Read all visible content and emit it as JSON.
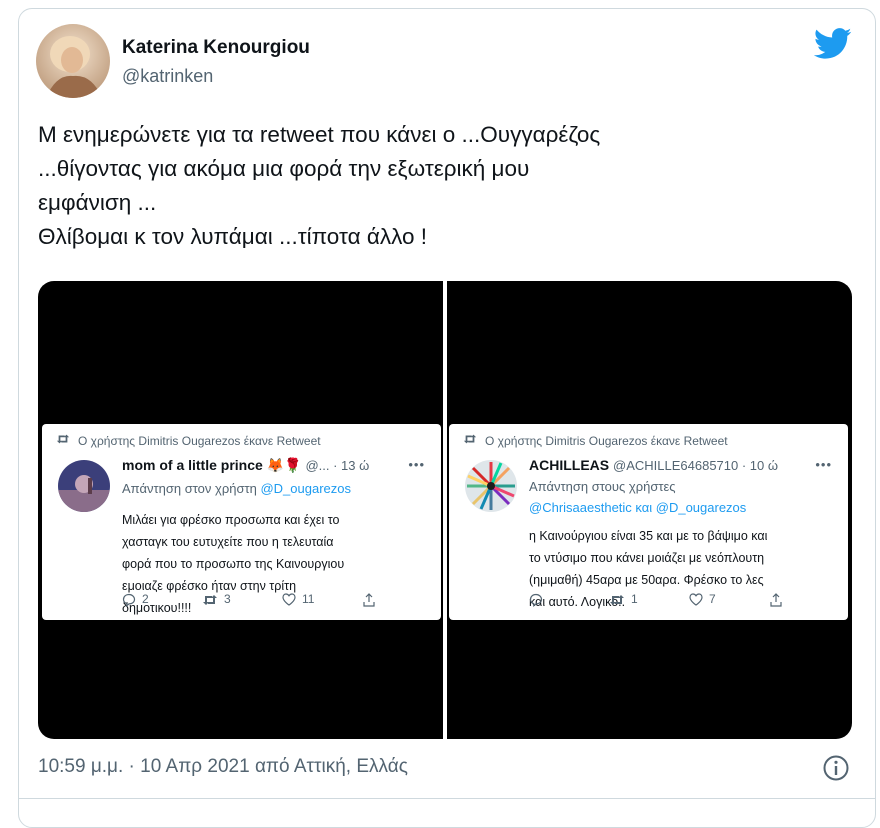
{
  "author": {
    "name": "Katerina Kenourgiou",
    "handle": "@katrinken"
  },
  "tweet": {
    "lines": [
      "Μ ενημερώνετε για τα retweet που κάνει ο ...Ουγγαρέζος",
      "...θίγοντας για ακόμα μια φορά την εξωτερική μου",
      "εμφάνιση ...",
      "Θλίβομαι κ τον λυπάμαι ...τίποτα άλλο !"
    ]
  },
  "media": {
    "left": {
      "retweet_notice": "Ο χρήστης Dimitris Ougarezos έκανε Retweet",
      "name": "mom of a little prince 🦊🌹",
      "handle_time": "@... · 13 ώ",
      "reply_prefix": "Απάντηση στον χρήστη ",
      "reply_mentions": "@D_ougarezos",
      "body_lines": [
        "Μιλάει για φρέσκο προσωπα και έχει το",
        "χασταγκ του ευτυχείτε που η τελευταία",
        "φορά που το προσωπο της Καινουργιου",
        "εμοιαζε φρέσκο ήταν στην τρίτη",
        "δημοτικου!!!!"
      ],
      "replies": "2",
      "retweets": "3",
      "likes": "11"
    },
    "right": {
      "retweet_notice": "Ο χρήστης Dimitris Ougarezos έκανε Retweet",
      "name": "ACHILLEAS",
      "handle_time": "@ACHILLE64685710 · 10 ώ",
      "reply_prefix": "Απάντηση στους χρήστες",
      "reply_mentions": "@Chrisaaesthetic και @D_ougarezos",
      "body_lines": [
        "η Καινούργιου είναι 35 και με το βάψιμο και",
        "το ντύσιμο που κάνει μοιάζει με νεόπλουτη",
        "(ημιμαθή) 45αρα με 50αρα. Φρέσκο το λες",
        "και αυτό. Λογικό.."
      ],
      "replies": "",
      "retweets": "1",
      "likes": "7"
    }
  },
  "timestamp": "10:59 μ.μ. · 10 Απρ 2021 από Αττική, Ελλάς",
  "colors": {
    "accent": "#1d9bf0",
    "muted": "#536471",
    "text": "#0f1419",
    "border": "#cfd9de"
  },
  "icons": [
    "twitter-bird-icon",
    "retweet-icon",
    "reply-icon",
    "like-icon",
    "share-icon",
    "info-icon",
    "more-icon"
  ]
}
